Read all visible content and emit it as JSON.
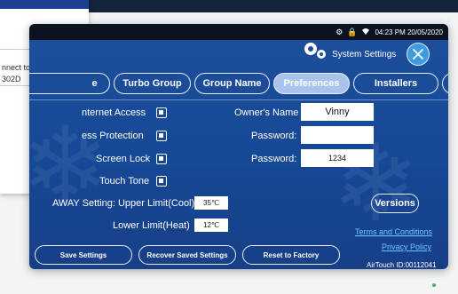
{
  "back_card": {
    "line1": "nnect to WiFi:",
    "line2": "302D"
  },
  "status_bar": {
    "time": "04:23 PM 20/05/2020"
  },
  "header": {
    "title": "System Settings"
  },
  "tabs": [
    {
      "label": "e"
    },
    {
      "label": "Turbo Group"
    },
    {
      "label": "Group Name"
    },
    {
      "label": "Preferences",
      "active": true
    },
    {
      "label": "Installers"
    }
  ],
  "settings": {
    "internet_access": "nternet Access",
    "access_protection": "ess Protection",
    "screen_lock": "Screen Lock",
    "touch_tone": "Touch Tone",
    "owners_name_label": "Owner's Name",
    "owners_name_value": "Vinny",
    "password_label_1": "Password:",
    "password_value_1": "",
    "password_label_2": "Password:",
    "password_value_2": "1234",
    "away_upper_label": "AWAY Setting: Upper Limit(Cool)",
    "away_upper_value": "35℃",
    "away_lower_label": "Lower Limit(Heat)",
    "away_lower_value": "12℃"
  },
  "buttons": {
    "versions": "Versions",
    "save": "Save Settings",
    "recover": "Recover Saved Settings",
    "reset": "Reset to Factory"
  },
  "links": {
    "terms": "Terms and Conditions",
    "privacy": "Privacy Policy"
  },
  "footer": {
    "device_id": "AirTouch ID:00112041"
  },
  "colors": {
    "panel_bg": "#1e4f9d",
    "active_tab": "#a9c4ec",
    "link": "#6cc6ff",
    "close_btn": "#3e9be0"
  }
}
